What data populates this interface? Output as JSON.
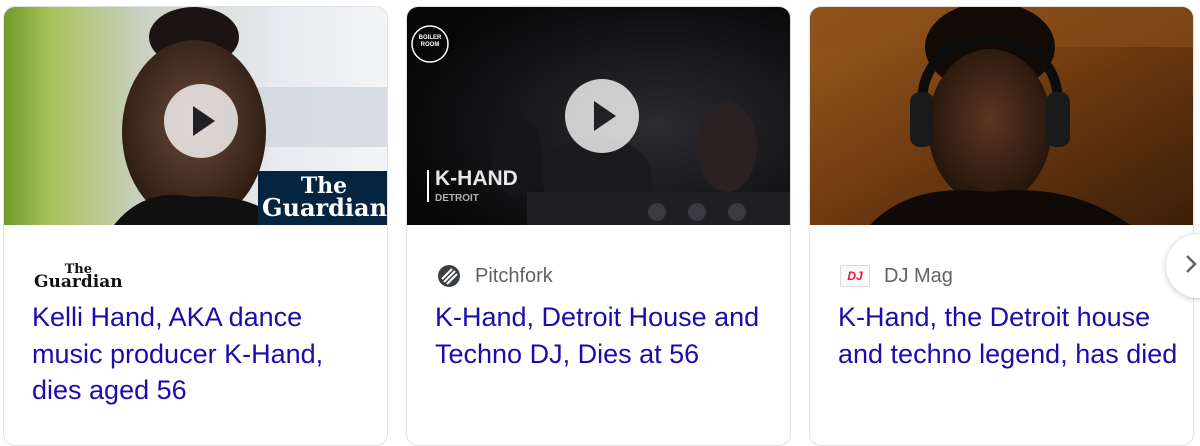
{
  "cards": [
    {
      "source_name": "The Guardian",
      "source_logo_line1": "The",
      "source_logo_line2": "Guardian",
      "headline": "Kelli Hand, AKA dance music producer K-Hand, dies aged 56",
      "thumbnail_watermark_line1": "The",
      "thumbnail_watermark_line2": "Guardian",
      "has_video": true
    },
    {
      "source_name": "Pitchfork",
      "headline": "K-Hand, Detroit House and Techno DJ, Dies at 56",
      "thumbnail_badge_line1": "BOILER",
      "thumbnail_badge_line2": "ROOM",
      "thumbnail_title": "K-HAND",
      "thumbnail_subtitle": "DETROIT",
      "has_video": true
    },
    {
      "source_name": "DJ Mag",
      "source_icon_text": "DJ",
      "headline": "K-Hand, the Detroit house and techno legend, has died",
      "has_video": false
    }
  ],
  "carousel": {
    "next_icon": "chevron-right-icon"
  },
  "colors": {
    "link": "#1a0dab",
    "source_text": "#5f6368",
    "border": "#dfe1e5"
  }
}
